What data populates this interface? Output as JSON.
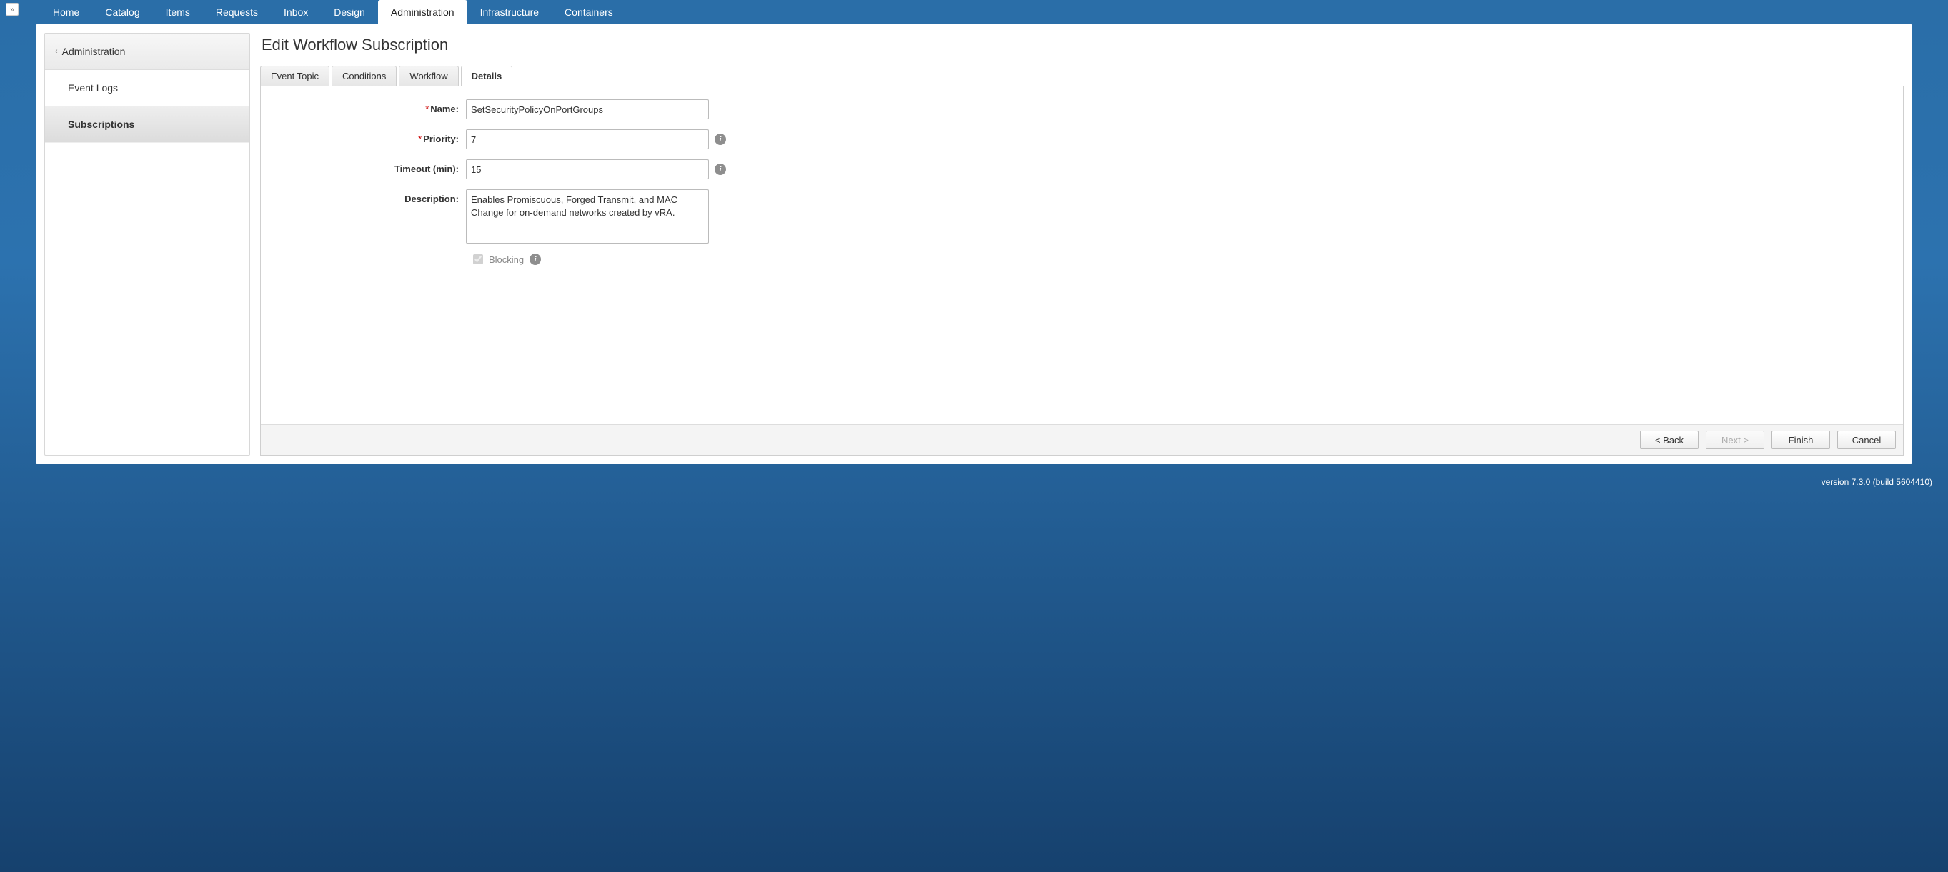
{
  "topnav": {
    "items": [
      {
        "label": "Home"
      },
      {
        "label": "Catalog"
      },
      {
        "label": "Items"
      },
      {
        "label": "Requests"
      },
      {
        "label": "Inbox"
      },
      {
        "label": "Design"
      },
      {
        "label": "Administration"
      },
      {
        "label": "Infrastructure"
      },
      {
        "label": "Containers"
      }
    ],
    "active_index": 6
  },
  "expand_glyph": "»",
  "sidepanel": {
    "header_label": "Administration",
    "items": [
      {
        "label": "Event Logs"
      },
      {
        "label": "Subscriptions"
      }
    ],
    "active_index": 1
  },
  "page_title": "Edit Workflow Subscription",
  "tabs": {
    "items": [
      {
        "label": "Event Topic"
      },
      {
        "label": "Conditions"
      },
      {
        "label": "Workflow"
      },
      {
        "label": "Details"
      }
    ],
    "active_index": 3
  },
  "form": {
    "name_label": "Name:",
    "name_value": "SetSecurityPolicyOnPortGroups",
    "priority_label": "Priority:",
    "priority_value": "7",
    "timeout_label": "Timeout (min):",
    "timeout_value": "15",
    "description_label": "Description:",
    "description_value": "Enables Promiscuous, Forged Transmit, and MAC Change for on-demand networks created by vRA.",
    "blocking_label": "Blocking",
    "blocking_checked": true
  },
  "info_glyph": "i",
  "required_marker": "*",
  "wizard": {
    "back_label": "< Back",
    "next_label": "Next >",
    "finish_label": "Finish",
    "cancel_label": "Cancel",
    "next_disabled": true
  },
  "footer": {
    "version_text": "version 7.3.0 (build 5604410)"
  }
}
